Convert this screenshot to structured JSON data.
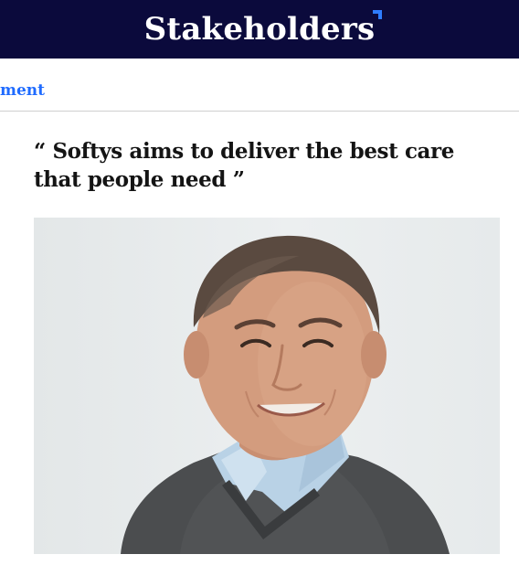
{
  "header": {
    "brand": "Stakeholders"
  },
  "section": {
    "label": "ment"
  },
  "article": {
    "quote_open": "“",
    "headline": "Softys aims to deliver the best care that people need",
    "quote_close": "”"
  },
  "colors": {
    "masthead_bg": "#0b0a3c",
    "brand_accent": "#2f7dff",
    "link": "#1f6bff",
    "headline": "#141414"
  }
}
